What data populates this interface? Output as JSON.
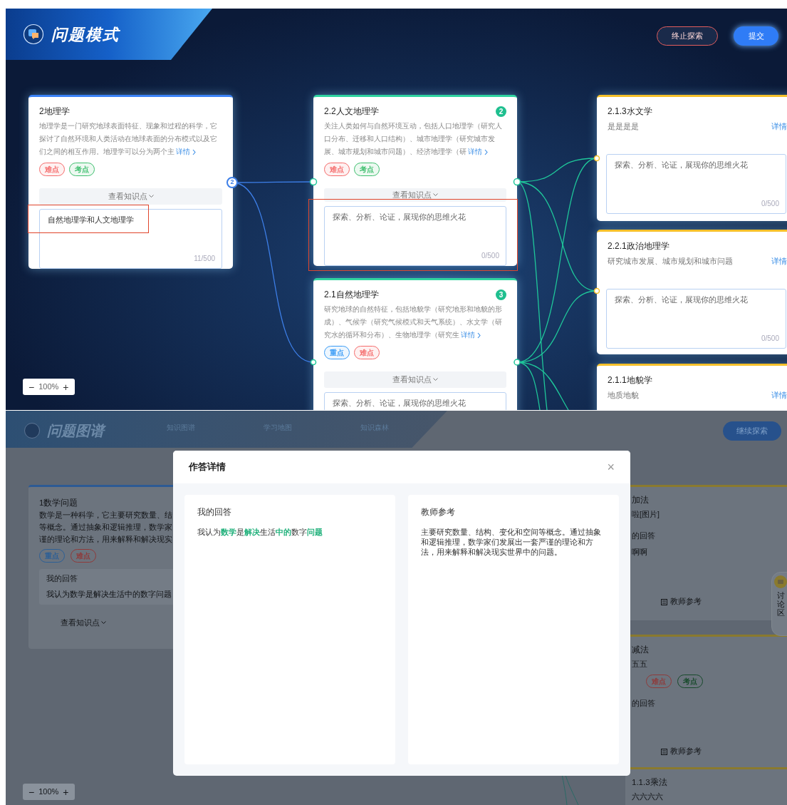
{
  "screen_1": {
    "header": {
      "title": "问题模式"
    },
    "buttons": [
      {
        "label": "终止探索",
        "kind": "outline"
      },
      {
        "label": "提交",
        "kind": "primary"
      }
    ],
    "nodes": [
      {
        "kind": "branch",
        "title": "2地理学",
        "color": "#3b82f6",
        "port_count": "2",
        "description": "地理学是一门研究地球表面特征、现象和过程的科学，它探讨了自然环境和人类活动在地球表面的分布模式以及它们之间的相互作用。地理学可以分为两个主",
        "detail": "详情",
        "tags": [
          {
            "label": "难点",
            "color": "#f56c6c"
          },
          {
            "label": "考点",
            "color": "#3fbf6f"
          }
        ],
        "knowledge_button": "查看知识点",
        "answer": {
          "value": "自然地理学和人文地理学",
          "counter": "11/500",
          "annotated": true
        }
      },
      {
        "kind": "branch",
        "title": "2.2人文地理学",
        "color": "#2fd3a0",
        "badge": "2",
        "description": "关注人类如何与自然环境互动，包括人口地理学（研究人口分布、迁移和人口结构）、城市地理学（研究城市发展、城市规划和城市问题）、经济地理学（研",
        "detail": "详情",
        "tags": [
          {
            "label": "难点",
            "color": "#f56c6c"
          },
          {
            "label": "考点",
            "color": "#3fbf6f"
          }
        ],
        "knowledge_button": "查看知识点",
        "answer": {
          "placeholder": "探索、分析、论证，展现你的思维火花",
          "counter": "0/500",
          "annotated": true
        }
      },
      {
        "kind": "branch",
        "title": "2.1自然地理学",
        "color": "#2fd3a0",
        "badge": "3",
        "description": "研究地球的自然特征，包括地貌学（研究地形和地貌的形成）、气候学（研究气候模式和天气系统）、水文学（研究水的循环和分布）、生物地理学（研究生",
        "detail": "详情",
        "tags": [
          {
            "label": "重点",
            "color": "#3b9cf6"
          },
          {
            "label": "难点",
            "color": "#f56c6c"
          }
        ],
        "knowledge_button": "查看知识点",
        "answer": {
          "placeholder": "探索、分析、论证，展现你的思维火花"
        }
      },
      {
        "kind": "leaf",
        "title": "2.1.3水文学",
        "color": "#f5c02a",
        "description": "是是是是",
        "detail": "详情",
        "answer": {
          "placeholder": "探索、分析、论证，展现你的思维火花",
          "counter": "0/500"
        }
      },
      {
        "kind": "leaf",
        "title": "2.2.1政治地理学",
        "color": "#f5c02a",
        "description": "研究城市发展、城市规划和城市问题",
        "detail": "详情",
        "answer": {
          "placeholder": "探索、分析、论证，展现你的思维火花",
          "counter": "0/500"
        }
      },
      {
        "kind": "leaf",
        "title": "2.1.1地貌学",
        "color": "#f5c02a",
        "description": "地质地貌",
        "detail": "详情"
      }
    ],
    "zoom": {
      "minus": "−",
      "value": "100%",
      "plus": "+"
    }
  },
  "screen_2": {
    "header": {
      "title": "问题图谱",
      "nav": [
        "知识图谱",
        "学习地图",
        "知识森林"
      ],
      "button": "继续探索"
    },
    "left_card": {
      "title": "1数学问题",
      "description_lines": [
        "数学是一种科学，它主要研究数量、结",
        "等概念。通过抽象和逻辑推理，数学家",
        "谨的理论和方法，用来解释和解决现实"
      ],
      "tags": [
        {
          "label": "重点",
          "color": "#2c5f96"
        },
        {
          "label": "难点",
          "color": "#8f3a3a"
        }
      ],
      "answer_label": "我的回答",
      "answer": "我认为数学是解决生活中的数字问题",
      "knowledge_button": "查看知识点"
    },
    "right_cards": [
      {
        "title": "加法",
        "description": "啦[图片]",
        "answer_label": "的回答",
        "answer": "啊啊",
        "teacher_button": "教师参考"
      },
      {
        "title": "减法",
        "description": "五五",
        "tags": [
          {
            "label": "难点",
            "color": "#8f3a3a"
          },
          {
            "label": "考点",
            "color": "#174a2b"
          }
        ],
        "answer_label": "的回答",
        "teacher_button": "教师参考"
      },
      {
        "title": "1.1.3乘法",
        "description": "六六六六"
      }
    ],
    "discussion_tab": "讨论区",
    "zoom": {
      "minus": "−",
      "value": "100%",
      "plus": "+"
    },
    "modal": {
      "title": "作答详情",
      "close": "×",
      "my_answer": {
        "label": "我的回答",
        "segments": [
          {
            "text": "我认为",
            "highlighted": false
          },
          {
            "text": "数学",
            "highlighted": true
          },
          {
            "text": "是",
            "highlighted": false
          },
          {
            "text": "解决",
            "highlighted": true
          },
          {
            "text": "生活",
            "highlighted": false
          },
          {
            "text": "中的",
            "highlighted": true
          },
          {
            "text": "数字",
            "highlighted": false
          },
          {
            "text": "问题",
            "highlighted": true
          }
        ]
      },
      "teacher_reference": {
        "label": "教师参考",
        "text": "主要研究数量、结构、变化和空间等概念。通过抽象和逻辑推理，数学家们发展出一套严谨的理论和方法，用来解释和解决现实世界中的问题。"
      }
    }
  }
}
